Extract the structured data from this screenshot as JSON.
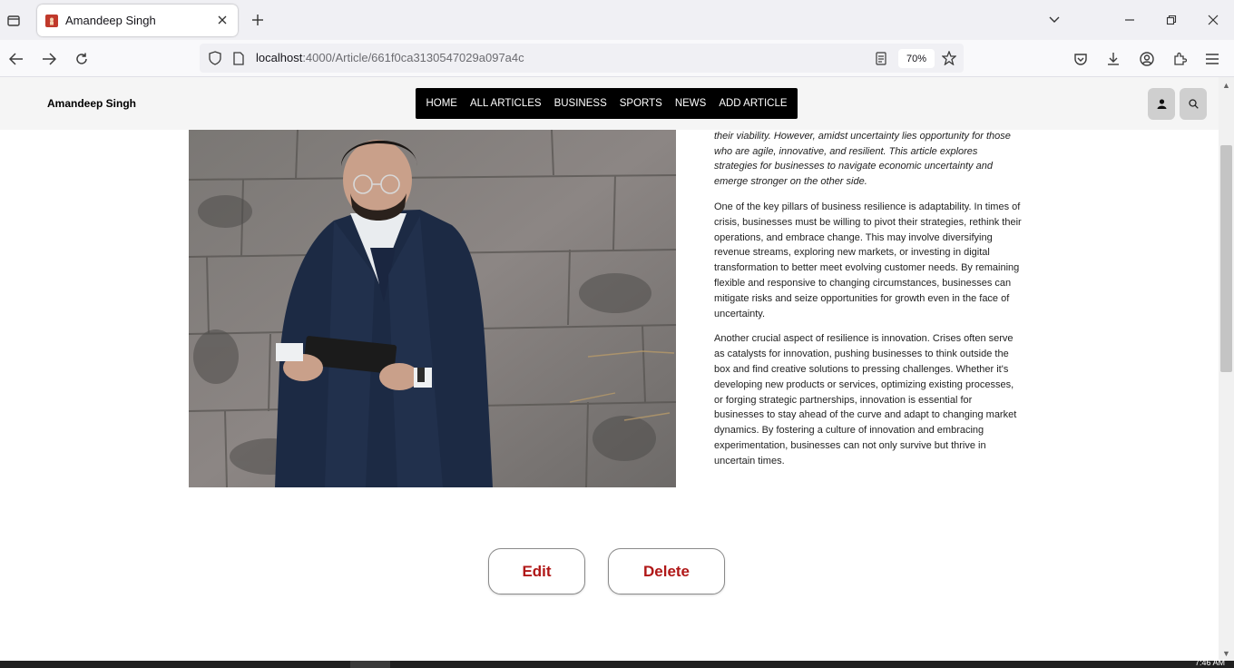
{
  "browser": {
    "tab_title": "Amandeep Singh",
    "url_host": "localhost",
    "url_path": ":4000/Article/661f0ca3130547029a097a4c",
    "zoom": "70%"
  },
  "site": {
    "brand": "Amandeep Singh",
    "nav": [
      "HOME",
      "ALL ARTICLES",
      "BUSINESS",
      "SPORTS",
      "NEWS",
      "ADD ARTICLE"
    ]
  },
  "article": {
    "intro": "pandemic, businesses face a myriad of challenges that can threaten their viability. However, amidst uncertainty lies opportunity for those who are agile, innovative, and resilient. This article explores strategies for businesses to navigate economic uncertainty and emerge stronger on the other side.",
    "paragraph_1": "One of the key pillars of business resilience is adaptability. In times of crisis, businesses must be willing to pivot their strategies, rethink their operations, and embrace change. This may involve diversifying revenue streams, exploring new markets, or investing in digital transformation to better meet evolving customer needs. By remaining flexible and responsive to changing circumstances, businesses can mitigate risks and seize opportunities for growth even in the face of uncertainty.",
    "paragraph_2": "Another crucial aspect of resilience is innovation. Crises often serve as catalysts for innovation, pushing businesses to think outside the box and find creative solutions to pressing challenges. Whether it's developing new products or services, optimizing existing processes, or forging strategic partnerships, innovation is essential for businesses to stay ahead of the curve and adapt to changing market dynamics. By fostering a culture of innovation and embracing experimentation, businesses can not only survive but thrive in uncertain times."
  },
  "actions": {
    "edit": "Edit",
    "delete": "Delete"
  },
  "taskbar": {
    "clock": "7:46 AM"
  }
}
